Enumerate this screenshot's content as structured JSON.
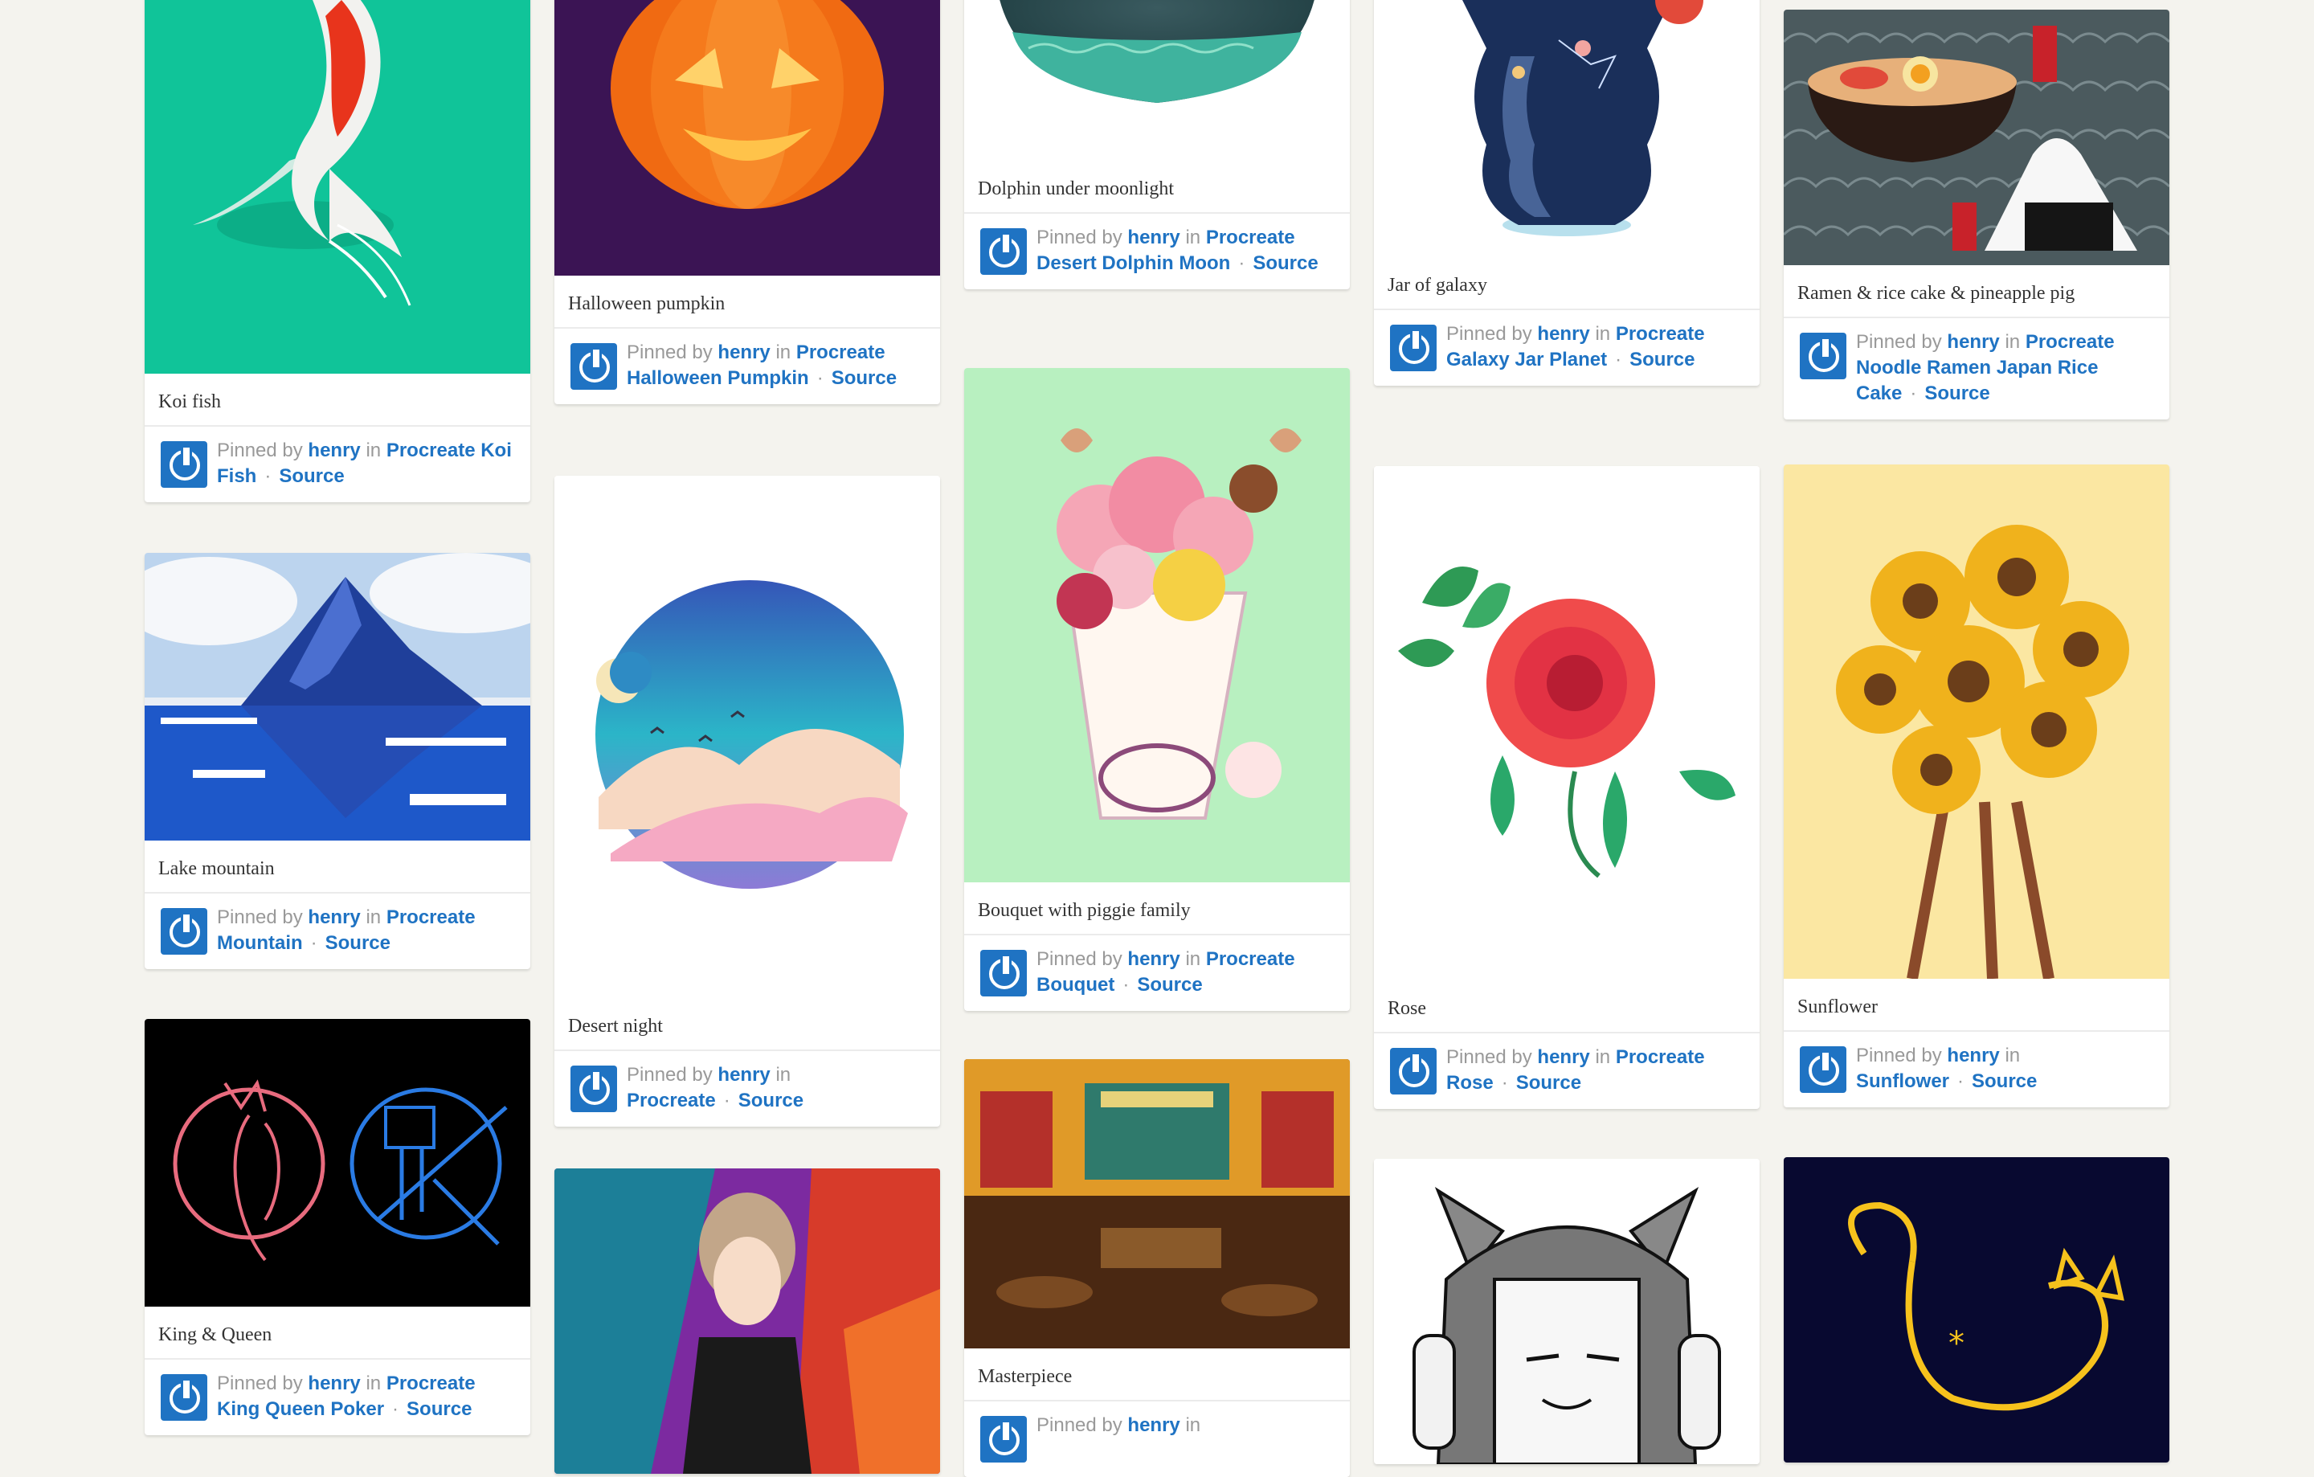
{
  "pins": [
    {
      "title": "Koi fish",
      "pinned_by": "Pinned by",
      "user": "henry",
      "in": "in",
      "board": "Procreate Koi Fish",
      "source": "Source"
    },
    {
      "title": "Lake mountain",
      "pinned_by": "Pinned by",
      "user": "henry",
      "in": "in",
      "board": "Procreate Mountain",
      "source": "Source"
    },
    {
      "title": "King & Queen",
      "pinned_by": "Pinned by",
      "user": "henry",
      "in": "in",
      "board": "Procreate King Queen Poker",
      "source": "Source"
    },
    {
      "title": "Halloween pumpkin",
      "pinned_by": "Pinned by",
      "user": "henry",
      "in": "in",
      "board": "Procreate Halloween Pumpkin",
      "source": "Source"
    },
    {
      "title": "Desert night",
      "pinned_by": "Pinned by",
      "user": "henry",
      "in": "in",
      "board": "Procreate",
      "source": "Source"
    },
    {
      "title": "Dolphin under moonlight",
      "pinned_by": "Pinned by",
      "user": "henry",
      "in": "in",
      "board": "Procreate Desert Dolphin Moon",
      "source": "Source"
    },
    {
      "title": "Bouquet with piggie family",
      "pinned_by": "Pinned by",
      "user": "henry",
      "in": "in",
      "board": "Procreate Bouquet",
      "source": "Source"
    },
    {
      "title": "Masterpiece",
      "pinned_by": "Pinned by",
      "user": "henry",
      "in": "in"
    },
    {
      "title": "Jar of galaxy",
      "pinned_by": "Pinned by",
      "user": "henry",
      "in": "in",
      "board": "Procreate Galaxy Jar Planet",
      "source": "Source"
    },
    {
      "title": "Rose",
      "pinned_by": "Pinned by",
      "user": "henry",
      "in": "in",
      "board": "Procreate Rose",
      "source": "Source"
    },
    {
      "title": "Ramen & rice cake & pineapple pig",
      "pinned_by": "Pinned by",
      "user": "henry",
      "in": "in",
      "board": "Procreate Noodle Ramen Japan Rice Cake",
      "source": "Source"
    },
    {
      "title": "Sunflower",
      "pinned_by": "Pinned by",
      "user": "henry",
      "in": "in",
      "board": "Sunflower",
      "source": "Source"
    }
  ],
  "colors": {
    "link": "#1f73c3",
    "background": "#f4f3ee",
    "meta_gray": "#999999"
  }
}
